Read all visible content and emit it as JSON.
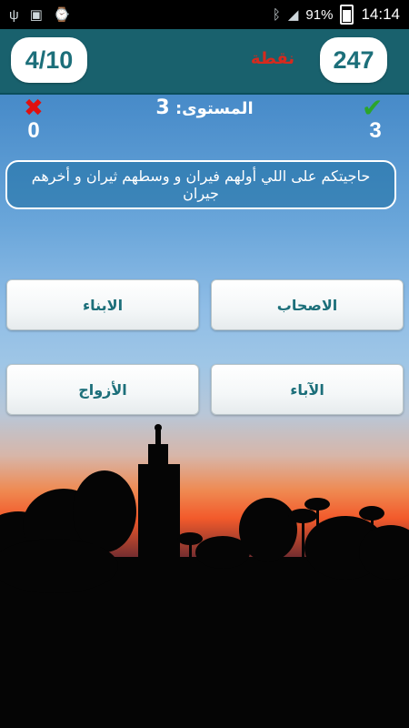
{
  "status_bar": {
    "icons_left": [
      "usb-icon",
      "image-icon",
      "watch-icon"
    ],
    "battery_percent": "91%",
    "time": "14:14"
  },
  "header": {
    "progress": "4/10",
    "points_label": "نقطة",
    "score": "247"
  },
  "stats": {
    "wrong_count": "0",
    "right_count": "3",
    "level_label": "المستوى:",
    "level_value": "3"
  },
  "question": "حاجيتكم على اللي أولهم فيران و وسطهم ثيران و أخرهم جيران",
  "answers": [
    "الاصحاب",
    "الابناء",
    "الآباء",
    "الأزواج"
  ],
  "colors": {
    "header": "#19616d",
    "accent_text": "#1c6f7a",
    "points_label": "#d62a1e",
    "wrong": "#e01010",
    "right": "#2ba52b"
  }
}
